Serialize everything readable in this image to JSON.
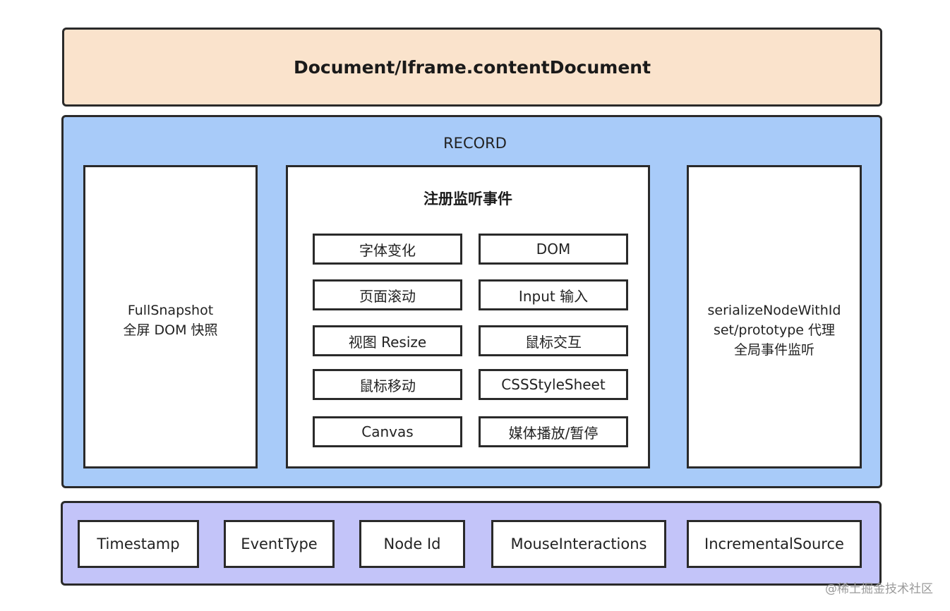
{
  "top": {
    "label": "Document/Iframe.contentDocument"
  },
  "record": {
    "title": "RECORD",
    "left_panel": {
      "line1": "FullSnapshot",
      "line2": "全屏 DOM 快照"
    },
    "events": {
      "title": "注册监听事件",
      "items": [
        "字体变化",
        "DOM",
        "页面滚动",
        "Input 输入",
        "视图 Resize",
        "鼠标交互",
        "鼠标移动",
        "CSSStyleSheet",
        "Canvas",
        "媒体播放/暂停"
      ]
    },
    "right_panel": {
      "line1": "serializeNodeWithId",
      "line2": "set/prototype 代理",
      "line3": "全局事件监听"
    }
  },
  "bottom": {
    "fields": [
      "Timestamp",
      "EventType",
      "Node Id",
      "MouseInteractions",
      "IncrementalSource"
    ]
  },
  "watermark": "@稀土掘金技术社区",
  "colors": {
    "top_bg": "#fae3cc",
    "record_bg": "#a8cbf9",
    "bottom_bg": "#c3c4f9",
    "border": "#2a2a2a"
  }
}
